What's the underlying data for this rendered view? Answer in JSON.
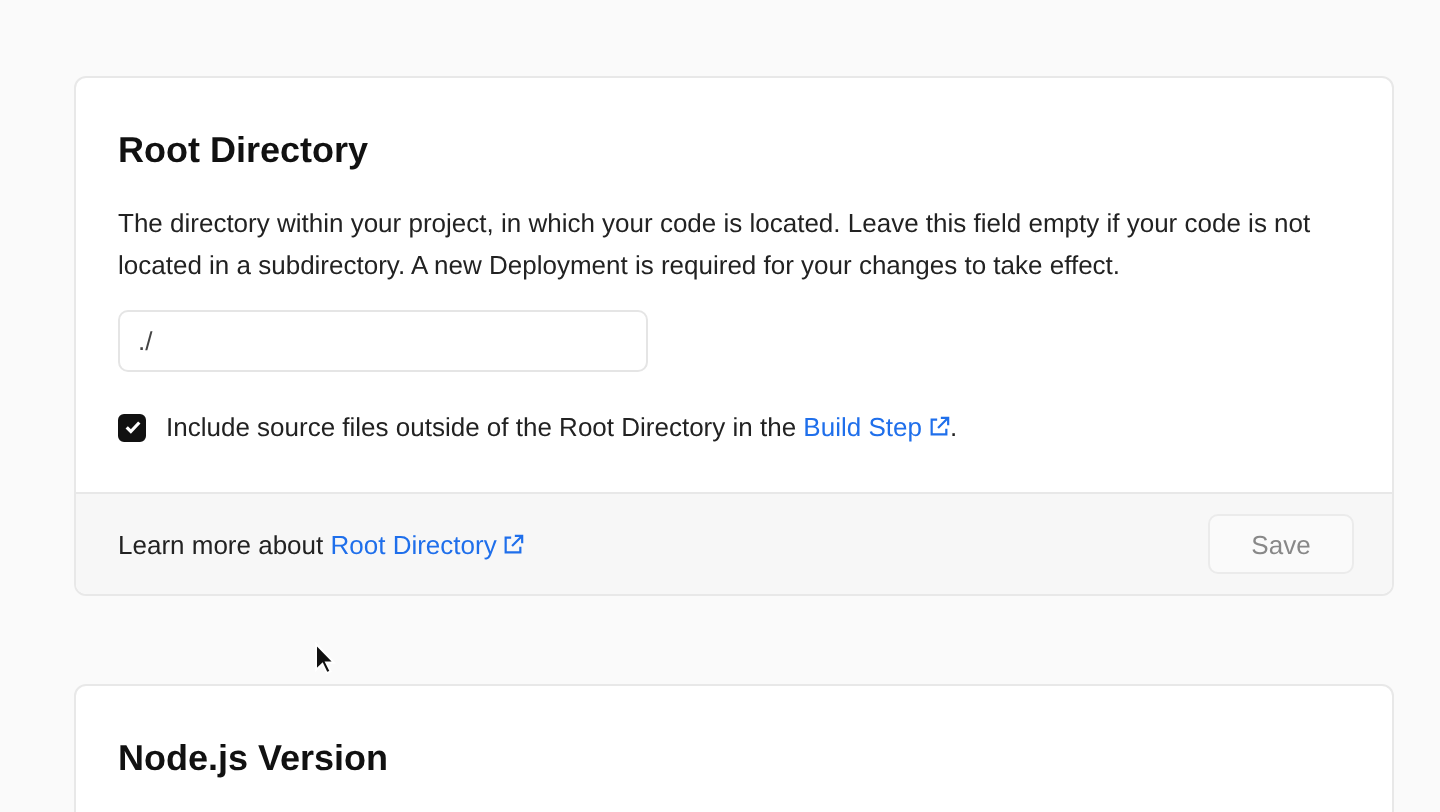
{
  "root_directory": {
    "title": "Root Directory",
    "description": "The directory within your project, in which your code is located. Leave this field empty if your code is not located in a subdirectory. A new Deployment is required for your changes to take effect.",
    "field": {
      "value": "./"
    },
    "checkbox": {
      "checked": true,
      "label": "Include source files outside of the Root Directory in the",
      "link": "Build Step",
      "suffix": "."
    },
    "footer": {
      "text": "Learn more about",
      "link": "Root Directory",
      "button": {
        "label": "Save",
        "disabled": true
      }
    }
  },
  "nodejs_version": {
    "title": "Node.js Version"
  }
}
